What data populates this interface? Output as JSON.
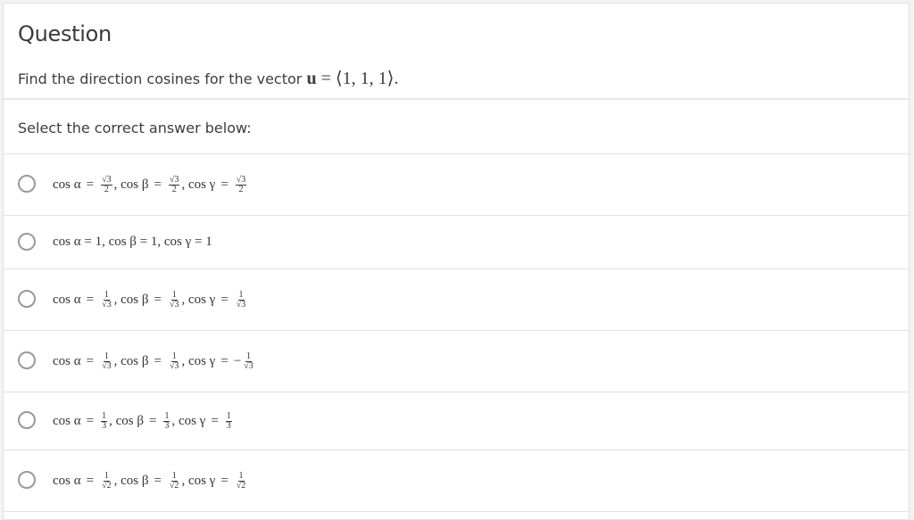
{
  "question": {
    "title": "Question",
    "text_prefix": "Find the direction cosines for the vector ",
    "vector_name": "u",
    "vector_value": " = ⟨1, 1, 1⟩."
  },
  "prompt": "Select the correct answer below:",
  "options": [
    {
      "a": [
        "√3",
        "2"
      ],
      "b": [
        "√3",
        "2"
      ],
      "g": [
        "√3",
        "2"
      ],
      "g_sign": ""
    },
    {
      "plain": "cos α = 1, cos β = 1, cos γ = 1"
    },
    {
      "a": [
        "1",
        "√3"
      ],
      "b": [
        "1",
        "√3"
      ],
      "g": [
        "1",
        "√3"
      ],
      "g_sign": ""
    },
    {
      "a": [
        "1",
        "√3"
      ],
      "b": [
        "1",
        "√3"
      ],
      "g": [
        "1",
        "√3"
      ],
      "g_sign": "−"
    },
    {
      "a": [
        "1",
        "3"
      ],
      "b": [
        "1",
        "3"
      ],
      "g": [
        "1",
        "3"
      ],
      "g_sign": ""
    },
    {
      "a": [
        "1",
        "√2"
      ],
      "b": [
        "1",
        "√2"
      ],
      "g": [
        "1",
        "√2"
      ],
      "g_sign": ""
    }
  ],
  "labels": {
    "cos_alpha": "cos α",
    "cos_beta": "cos β",
    "cos_gamma": "cos γ",
    "equals": "=",
    "comma": ","
  }
}
